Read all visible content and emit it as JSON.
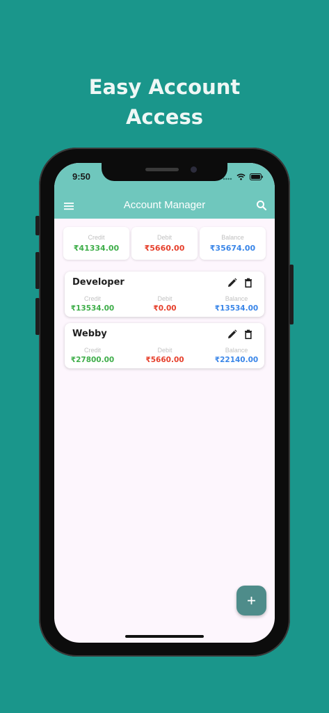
{
  "promo": {
    "headline_line1": "Easy Account",
    "headline_line2": "Access"
  },
  "status_bar": {
    "time": "9:50"
  },
  "app": {
    "title": "Account Manager"
  },
  "colors": {
    "accent": "#6fc7bd",
    "credit": "#3fae4a",
    "debit": "#e6402c",
    "balance": "#3a86e8",
    "background": "#1a968b",
    "fab": "#4e8c8a"
  },
  "icons": {
    "menu": "menu-icon",
    "search": "search-icon",
    "edit": "pencil-icon",
    "delete": "trash-icon",
    "add": "plus-icon"
  },
  "summary": {
    "credit_label": "Credit",
    "credit_value": "₹41334.00",
    "debit_label": "Debit",
    "debit_value": "₹5660.00",
    "balance_label": "Balance",
    "balance_value": "₹35674.00"
  },
  "accounts": [
    {
      "name": "Developer",
      "credit_label": "Credit",
      "credit": "₹13534.00",
      "debit_label": "Debit",
      "debit": "₹0.00",
      "balance_label": "Balance",
      "balance": "₹13534.00"
    },
    {
      "name": "Webby",
      "credit_label": "Credit",
      "credit": "₹27800.00",
      "debit_label": "Debit",
      "debit": "₹5660.00",
      "balance_label": "Balance",
      "balance": "₹22140.00"
    }
  ]
}
